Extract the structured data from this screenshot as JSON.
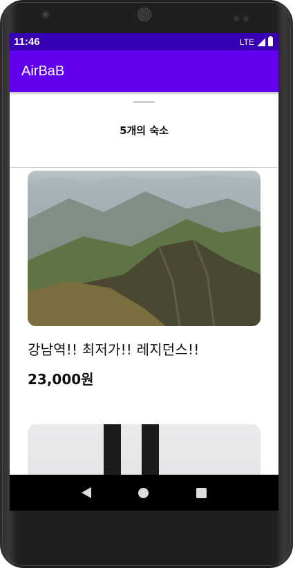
{
  "status_bar": {
    "time": "11:46",
    "network": "LTE"
  },
  "app_bar": {
    "title": "AirBaB"
  },
  "sheet": {
    "title": "5개의 숙소"
  },
  "listings": [
    {
      "name": "강남역!! 최저가!! 레지던스!!",
      "price": "23,000원",
      "photo": "mountain-landscape"
    },
    {
      "photo": "person-standing"
    }
  ],
  "nav_bar": {
    "buttons": [
      "back-icon",
      "home-icon",
      "recents-icon"
    ]
  },
  "colors": {
    "status_bar": "#3700b3",
    "app_bar": "#6200ee"
  }
}
